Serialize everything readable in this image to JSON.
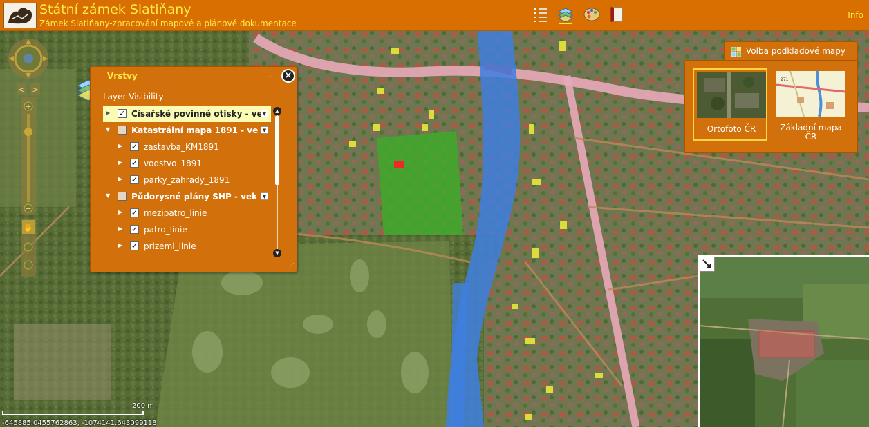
{
  "header": {
    "title": "Státní zámek Slatiňany",
    "subtitle": "Zámek Slatiňany-zpracování mapové a plánové dokumentace",
    "info_link": "Info",
    "tools": [
      "legend-list-icon",
      "layers-icon",
      "palette-icon",
      "book-icon"
    ]
  },
  "layers_panel": {
    "title": "Vrstvy",
    "visibility_label": "Layer Visibility",
    "items": [
      {
        "label": "Císařské povinné otisky - ve",
        "checked": true,
        "selected": true,
        "group": true
      },
      {
        "label": "Katastrální mapa 1891 - ve",
        "checked": false,
        "selected": false,
        "group": true
      },
      {
        "label": "zastavba_KM1891",
        "checked": true,
        "selected": false,
        "group": false
      },
      {
        "label": "vodstvo_1891",
        "checked": true,
        "selected": false,
        "group": false
      },
      {
        "label": "parky_zahrady_1891",
        "checked": true,
        "selected": false,
        "group": false
      },
      {
        "label": "Půdorysné plány SHP - vek",
        "checked": false,
        "selected": false,
        "group": true
      },
      {
        "label": "mezipatro_linie",
        "checked": true,
        "selected": false,
        "group": false
      },
      {
        "label": "patro_linie",
        "checked": true,
        "selected": false,
        "group": false
      },
      {
        "label": "prizemi_linie",
        "checked": true,
        "selected": false,
        "group": false
      }
    ]
  },
  "basemap": {
    "tab_label": "Volba podkladové mapy",
    "options": [
      {
        "label": "Ortofoto ČR",
        "active": true
      },
      {
        "label": "Základní mapa ČR",
        "active": false
      }
    ]
  },
  "scale": {
    "label": "200 m"
  },
  "coordinates": "-645885.0455762863, -1074141.643099118",
  "colors": {
    "header": "#d86f00",
    "title_text": "#ffe94a",
    "panel": "#d2700b",
    "river": "#3f7fe0",
    "road": "#e7aab8"
  }
}
